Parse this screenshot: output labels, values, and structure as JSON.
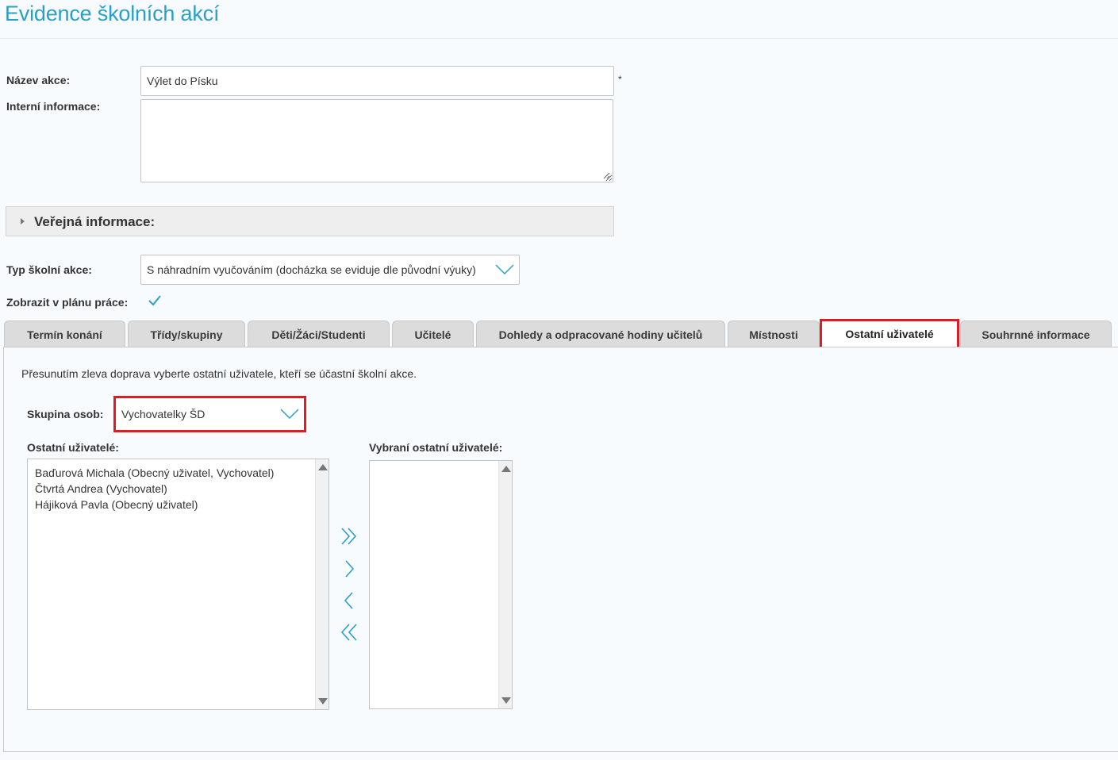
{
  "page": {
    "title": "Evidence školních akcí"
  },
  "form": {
    "name_label": "Název akce:",
    "name_value": "Výlet do Písku",
    "required_mark": "*",
    "internal_label": "Interní informace:",
    "internal_value": "",
    "public_section_title": "Veřejná informace:",
    "type_label": "Typ školní akce:",
    "type_value": "S náhradním vyučováním (docházka se eviduje dle původní výuky)",
    "show_in_plan_label": "Zobrazit v plánu práce:",
    "show_in_plan_checked": true
  },
  "tabs": [
    {
      "label": "Termín konání",
      "active": false
    },
    {
      "label": "Třídy/skupiny",
      "active": false
    },
    {
      "label": "Děti/Žáci/Studenti",
      "active": false
    },
    {
      "label": "Učitelé",
      "active": false
    },
    {
      "label": "Dohledy a odpracované hodiny učitelů",
      "active": false
    },
    {
      "label": "Místnosti",
      "active": false
    },
    {
      "label": "Ostatní uživatelé",
      "active": true
    },
    {
      "label": "Souhrnné informace",
      "active": false
    }
  ],
  "panel": {
    "instruction": "Přesunutím zleva doprava vyberte ostatní uživatele, kteří se účastní školní akce.",
    "group_label": "Skupina osob:",
    "group_value": "Vychovatelky ŠD",
    "available_label": "Ostatní uživatelé:",
    "available_users": [
      "Baďurová Michala (Obecný uživatel, Vychovatel)",
      "Čtvrtá Andrea (Vychovatel)",
      "Hájiková Pavla (Obecný uživatel)"
    ],
    "selected_label": "Vybraní ostatní uživatelé:",
    "selected_users": []
  },
  "icons": {
    "move_all_right": "double-chevron-right-icon",
    "move_right": "chevron-right-icon",
    "move_left": "chevron-left-icon",
    "move_all_left": "double-chevron-left-icon"
  },
  "colors": {
    "accent": "#2a9fc9",
    "highlight": "#e01b24"
  }
}
